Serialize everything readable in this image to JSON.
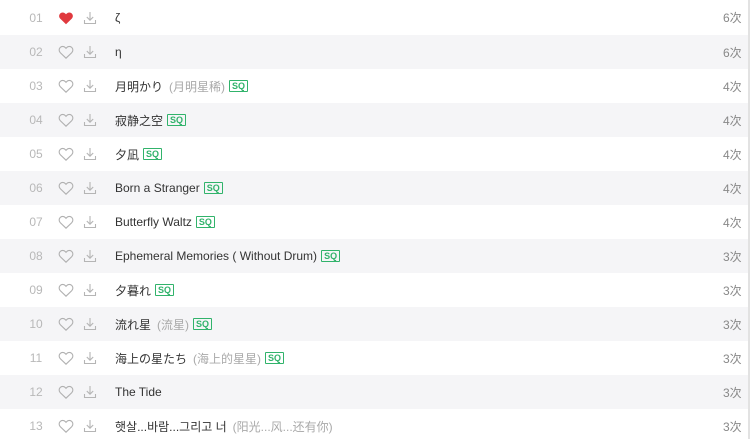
{
  "tracks": [
    {
      "index": "01",
      "title": "ζ",
      "alias": "",
      "sq": "",
      "plays": "6次",
      "liked": true
    },
    {
      "index": "02",
      "title": "η",
      "alias": "",
      "sq": "",
      "plays": "6次",
      "liked": false
    },
    {
      "index": "03",
      "title": "月明かり",
      "alias": "(月明星稀)",
      "sq": "SQ",
      "plays": "4次",
      "liked": false
    },
    {
      "index": "04",
      "title": "寂静之空",
      "alias": "",
      "sq": "SQ",
      "plays": "4次",
      "liked": false
    },
    {
      "index": "05",
      "title": "夕凪",
      "alias": "",
      "sq": "SQ",
      "plays": "4次",
      "liked": false
    },
    {
      "index": "06",
      "title": "Born a Stranger",
      "alias": "",
      "sq": "SQ",
      "plays": "4次",
      "liked": false
    },
    {
      "index": "07",
      "title": "Butterfly Waltz",
      "alias": "",
      "sq": "SQ",
      "plays": "4次",
      "liked": false
    },
    {
      "index": "08",
      "title": "Ephemeral Memories ( Without Drum)",
      "alias": "",
      "sq": "SQ",
      "plays": "3次",
      "liked": false
    },
    {
      "index": "09",
      "title": "夕暮れ",
      "alias": "",
      "sq": "SQ",
      "plays": "3次",
      "liked": false
    },
    {
      "index": "10",
      "title": "流れ星",
      "alias": "(流星)",
      "sq": "SQ",
      "plays": "3次",
      "liked": false
    },
    {
      "index": "11",
      "title": "海上の星たち",
      "alias": "(海上的星星)",
      "sq": "SQ",
      "plays": "3次",
      "liked": false
    },
    {
      "index": "12",
      "title": "The Tide",
      "alias": "",
      "sq": "",
      "plays": "3次",
      "liked": false
    },
    {
      "index": "13",
      "title": "햇살...바람...그리고 너",
      "alias": "(阳光...风...还有你)",
      "sq": "",
      "plays": "3次",
      "liked": false
    }
  ],
  "icons": {
    "like": "heart-icon",
    "download": "download-icon"
  },
  "colors": {
    "liked": "#e0393e",
    "unliked_stroke": "#b0b0b0",
    "sq_badge": "#31b36b",
    "row_alt": "#f5f5f7"
  }
}
